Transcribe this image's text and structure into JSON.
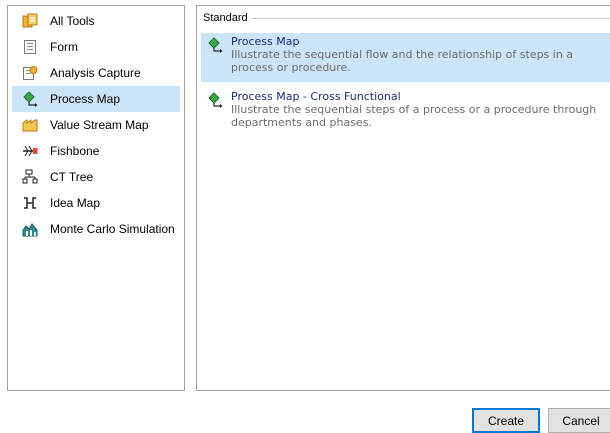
{
  "tools": [
    {
      "label": "All Tools",
      "icon": "all-tools-icon"
    },
    {
      "label": "Form",
      "icon": "form-icon"
    },
    {
      "label": "Analysis Capture",
      "icon": "analysis-capture-icon"
    },
    {
      "label": "Process Map",
      "icon": "process-map-icon",
      "selected": true
    },
    {
      "label": "Value Stream Map",
      "icon": "value-stream-map-icon"
    },
    {
      "label": "Fishbone",
      "icon": "fishbone-icon"
    },
    {
      "label": "CT Tree",
      "icon": "ct-tree-icon"
    },
    {
      "label": "Idea Map",
      "icon": "idea-map-icon"
    },
    {
      "label": "Monte Carlo Simulation",
      "icon": "monte-carlo-simulation-icon"
    }
  ],
  "group": {
    "title": "Standard"
  },
  "templates": [
    {
      "name": "Process Map",
      "description_line1": "Illustrate the sequential flow and the relationship of steps in a",
      "description_line2": "process or procedure.",
      "selected": true
    },
    {
      "name": "Process Map - Cross Functional",
      "description_line1": "Illustrate the sequential steps of a process or a procedure through",
      "description_line2": "departments and phases.",
      "selected": false
    }
  ],
  "buttons": {
    "create": "Create",
    "cancel": "Cancel"
  },
  "colors": {
    "selection": "#cce4f7",
    "template_name": "#1b2a78",
    "description": "#6c6c6c",
    "default_button_border": "#0078d7"
  }
}
